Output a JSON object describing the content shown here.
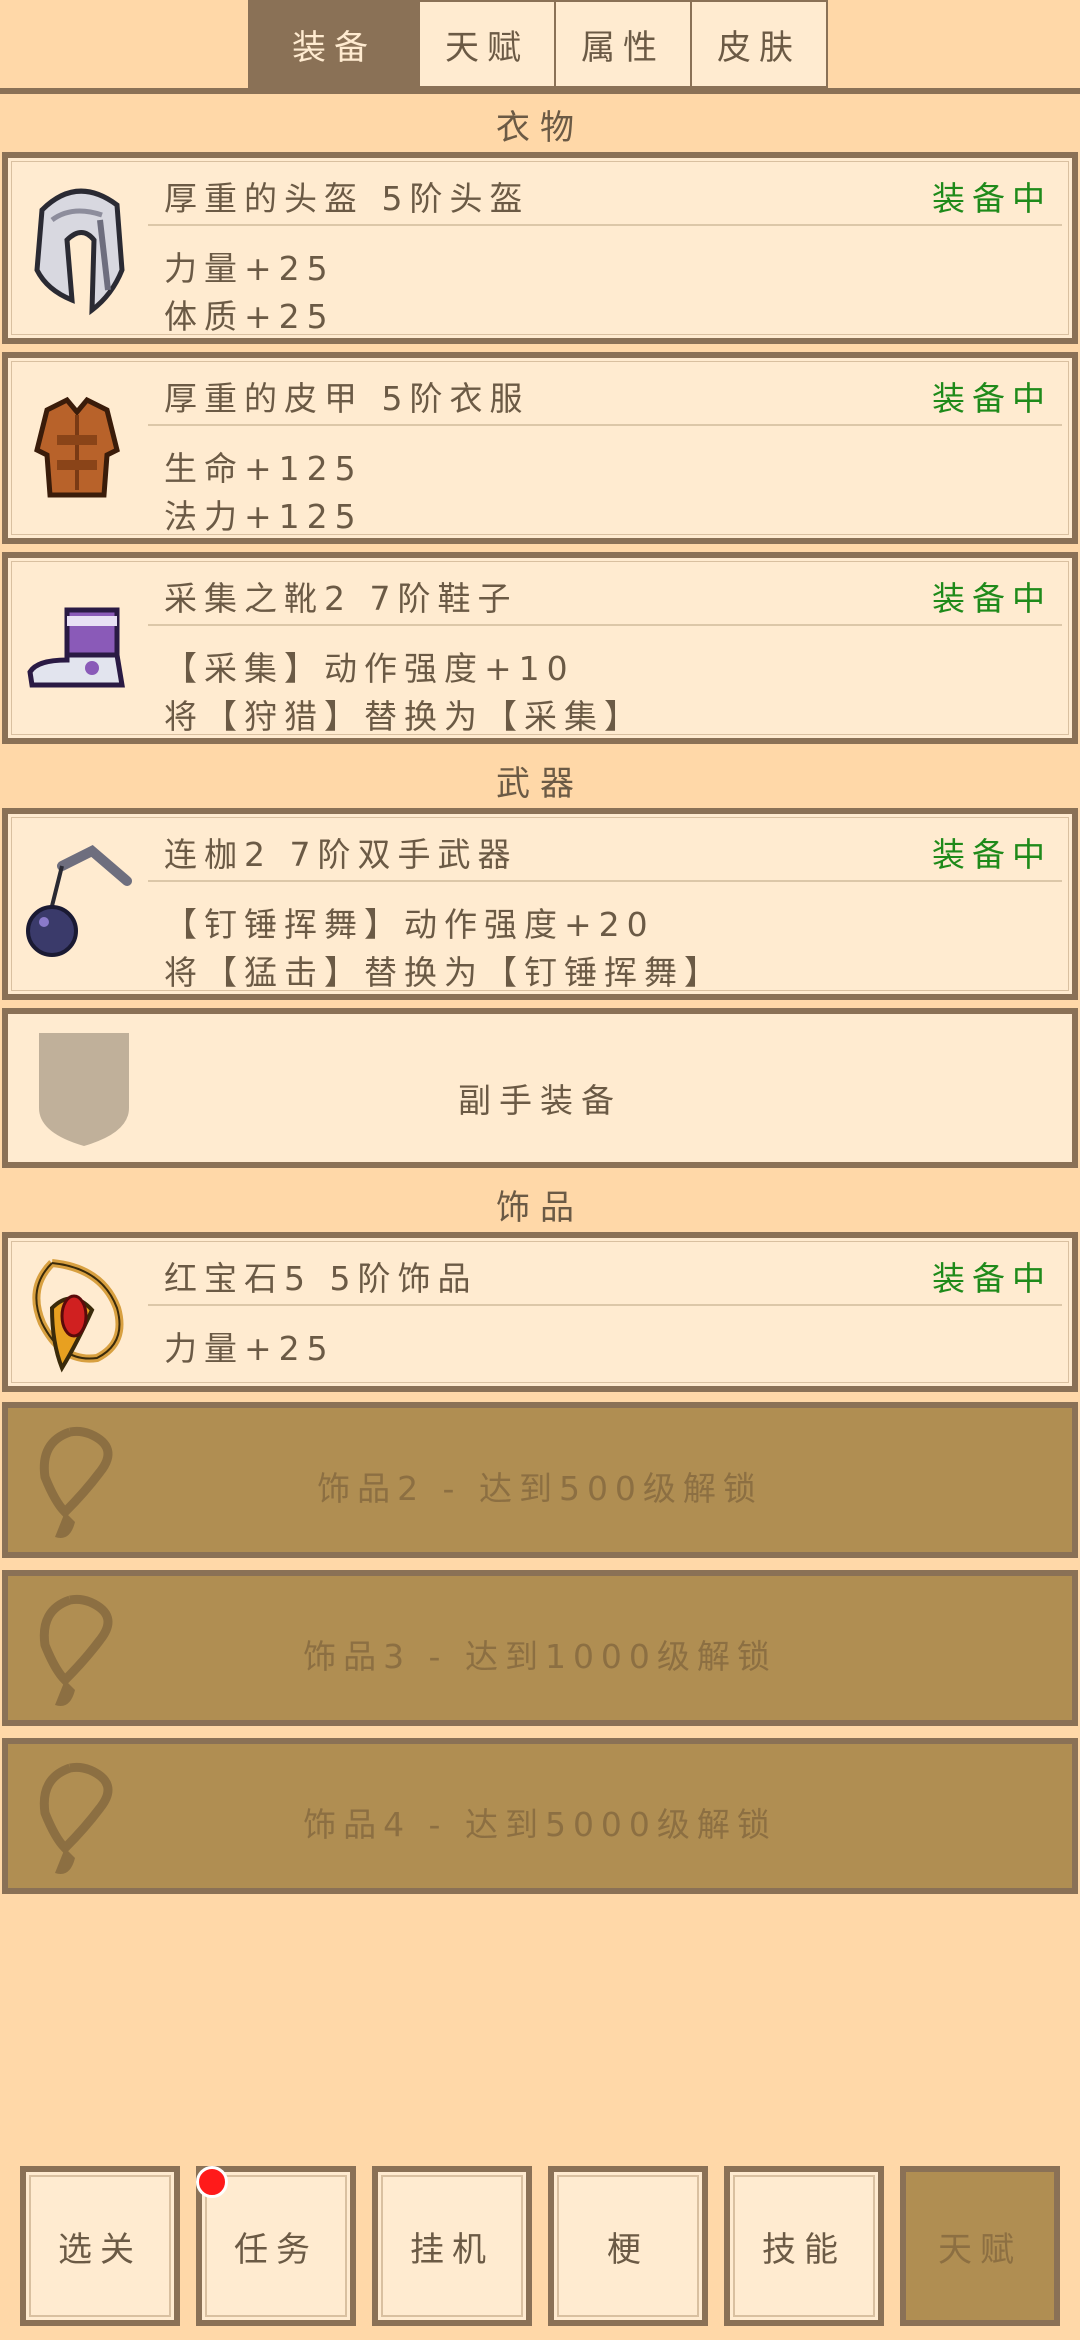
{
  "tabs": [
    {
      "label": "装备",
      "active": true
    },
    {
      "label": "天赋",
      "active": false
    },
    {
      "label": "属性",
      "active": false
    },
    {
      "label": "皮肤",
      "active": false
    }
  ],
  "sections": {
    "clothing": "衣物",
    "weapons": "武器",
    "accessories": "饰品"
  },
  "equipped_status": "装备中",
  "items": {
    "helmet": {
      "title": "厚重的头盔  5阶头盔",
      "lines": [
        "力量+25",
        "体质+25"
      ],
      "icon": "helmet-icon"
    },
    "armor": {
      "title": "厚重的皮甲  5阶衣服",
      "lines": [
        "生命+125",
        "法力+125"
      ],
      "icon": "leather-armor-icon"
    },
    "boots": {
      "title": "采集之靴2  7阶鞋子",
      "lines": [
        "【采集】动作强度+10",
        "将【狩猎】替换为【采集】"
      ],
      "icon": "boots-icon"
    },
    "weapon": {
      "title": "连枷2  7阶双手武器",
      "lines": [
        "【钉锤挥舞】动作强度+20",
        "将【猛击】替换为【钉锤挥舞】"
      ],
      "icon": "flail-icon"
    },
    "offhand": {
      "label": "副手装备",
      "icon": "shield-placeholder-icon"
    },
    "ruby": {
      "title": "红宝石5  5阶饰品",
      "lines": [
        "力量+25"
      ],
      "icon": "ruby-amulet-icon"
    }
  },
  "locked_slots": [
    {
      "label": "饰品2 - 达到500级解锁"
    },
    {
      "label": "饰品3 - 达到1000级解锁"
    },
    {
      "label": "饰品4 - 达到5000级解锁"
    }
  ],
  "bottom_nav": [
    {
      "label": "选关",
      "active": false,
      "badge": false
    },
    {
      "label": "任务",
      "active": false,
      "badge": true
    },
    {
      "label": "挂机",
      "active": false,
      "badge": false
    },
    {
      "label": "梗",
      "active": false,
      "badge": false
    },
    {
      "label": "技能",
      "active": false,
      "badge": false
    },
    {
      "label": "天赋",
      "active": true,
      "badge": false
    }
  ],
  "colors": {
    "background": "#ffd8a8",
    "card": "#ffebd0",
    "border": "#8a7156",
    "equipped": "#1f8a1a",
    "locked": "#b08e52"
  }
}
